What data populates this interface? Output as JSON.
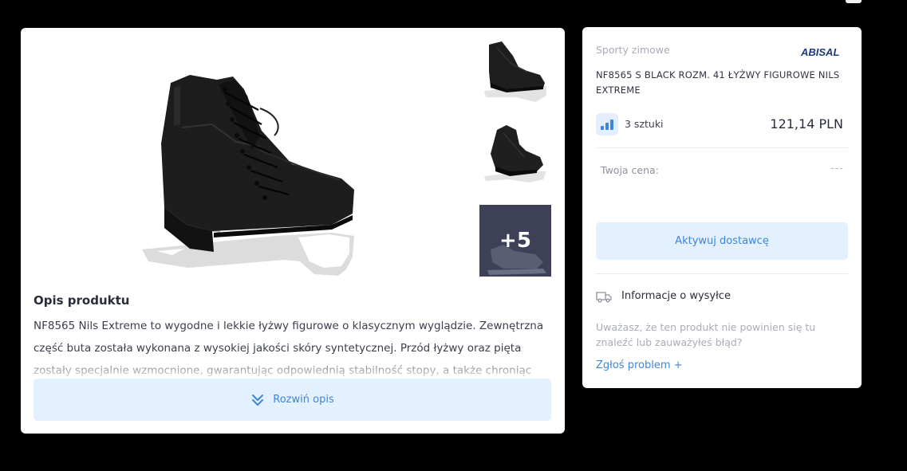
{
  "gallery": {
    "more_count_label": "+5"
  },
  "description": {
    "title": "Opis produktu",
    "text": "NF8565 Nils Extreme to wygodne i lekkie łyżwy figurowe o klasycznym wyglądzie. Zewnętrzna część buta została wykonana z wysokiej jakości skóry syntetycznej. Przód łyżwy oraz pięta zostały specjalnie wzmocnione, gwarantując odpowiednią stabilność stopy, a także chroniąc",
    "expand_label": "Rozwiń opis"
  },
  "product": {
    "category": "Sporty zimowe",
    "brand": "ABISAL",
    "title": "NF8565 S BLACK ROZM. 41 ŁYŻWY FIGUROWE NILS EXTREME",
    "stock": "3 sztuki",
    "price": "121,14 PLN",
    "your_price_label": "Twoja cena:",
    "your_price_value": "---",
    "activate_label": "Aktywuj dostawcę",
    "shipping_label": "Informacje o wysyłce",
    "report_question": "Uważasz, że ten produkt nie powinien się tu znaleźć lub zauważyłeś błąd?",
    "report_link": "Zgłoś problem +"
  },
  "colors": {
    "accent": "#3f85d8",
    "accent_bg": "#e3f0fd",
    "thumb_overlay": "#3d4056"
  }
}
